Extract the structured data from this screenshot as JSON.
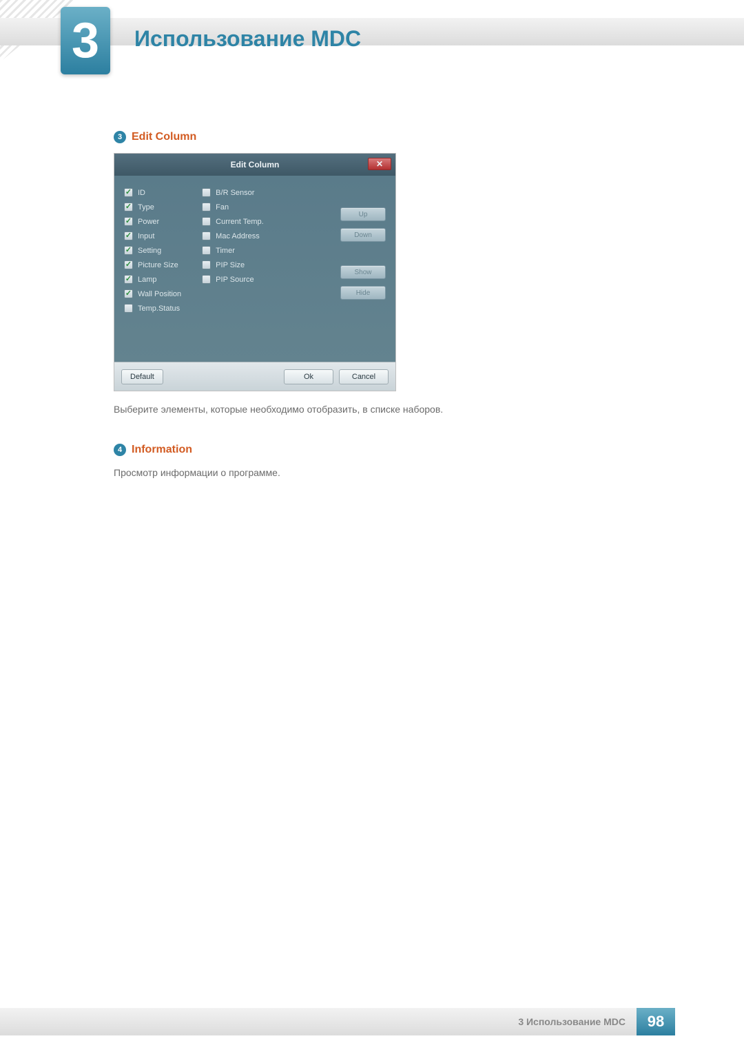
{
  "chapter": {
    "number": "3",
    "title": "Использование MDC"
  },
  "section3": {
    "bullet_num": "3",
    "label": "Edit Column",
    "caption": "Выберите элементы, которые необходимо отобразить, в списке наборов."
  },
  "dialog": {
    "title": "Edit Column",
    "close_glyph": "✕",
    "left_items": [
      {
        "label": "ID",
        "checked": true
      },
      {
        "label": "Type",
        "checked": true
      },
      {
        "label": "Power",
        "checked": true
      },
      {
        "label": "Input",
        "checked": true
      },
      {
        "label": "Setting",
        "checked": true
      },
      {
        "label": "Picture Size",
        "checked": true
      },
      {
        "label": "Lamp",
        "checked": true
      },
      {
        "label": "Wall Position",
        "checked": true
      },
      {
        "label": "Temp.Status",
        "checked": false
      }
    ],
    "right_items": [
      {
        "label": "B/R Sensor",
        "checked": false
      },
      {
        "label": "Fan",
        "checked": false
      },
      {
        "label": "Current Temp.",
        "checked": false
      },
      {
        "label": "Mac Address",
        "checked": false
      },
      {
        "label": "Timer",
        "checked": false
      },
      {
        "label": "PIP Size",
        "checked": false
      },
      {
        "label": "PIP Source",
        "checked": false
      }
    ],
    "side_buttons": {
      "up": "Up",
      "down": "Down",
      "show": "Show",
      "hide": "Hide"
    },
    "footer": {
      "default": "Default",
      "ok": "Ok",
      "cancel": "Cancel"
    }
  },
  "section4": {
    "bullet_num": "4",
    "label": "Information",
    "caption": "Просмотр информации о программе."
  },
  "page_footer": {
    "label": "3 Использование MDC",
    "page": "98"
  }
}
